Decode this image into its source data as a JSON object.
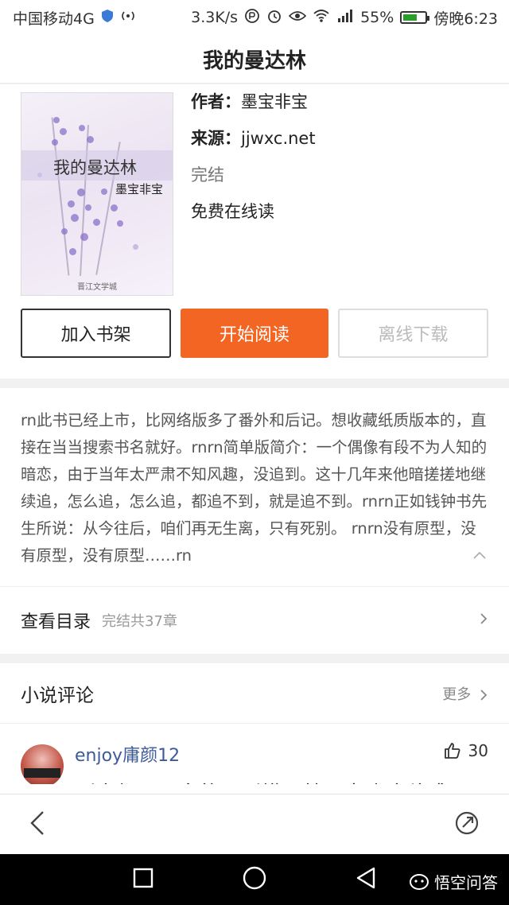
{
  "status_bar": {
    "carrier": "中国移动4G",
    "speed": "3.3K/s",
    "battery": "55%",
    "time": "傍晚6:23"
  },
  "header": {
    "title": "我的曼达林"
  },
  "cover": {
    "title": "我的曼达林",
    "author": "墨宝非宝",
    "publisher": "晋江文学城"
  },
  "book": {
    "author_label": "作者：",
    "author": "墨宝非宝",
    "source_label": "来源：",
    "source": "jjwxc.net",
    "status": "完结",
    "price": "免费在线读"
  },
  "actions": {
    "add_shelf": "加入书架",
    "start_reading": "开始阅读",
    "offline_download": "离线下载"
  },
  "description": "rn此书已经上市，比网络版多了番外和后记。想收藏纸质版本的，直接在当当搜索书名就好。rnrn简单版简介：一个偶像有段不为人知的暗恋，由于当年太严肃不知风趣，没追到。这十几年来他暗搓搓地继续追，怎么追，怎么追，都追不到，就是追不到。rnrn正如钱钟书先生所说：从今往后，咱们再无生离，只有死别。 rnrn没有原型，没有原型，没有原型……rn",
  "toc": {
    "title": "查看目录",
    "subtitle": "完结共37章"
  },
  "reviews": {
    "title": "小说评论",
    "more": "更多",
    "items": [
      {
        "user": "enjoy庸颜12",
        "likes": "30",
        "text": "别人都不是白的，别横，就是喜欢这种感"
      }
    ]
  },
  "brand": {
    "name": "悟空问答"
  },
  "colors": {
    "accent": "#f26522",
    "username": "#3d5a99"
  }
}
